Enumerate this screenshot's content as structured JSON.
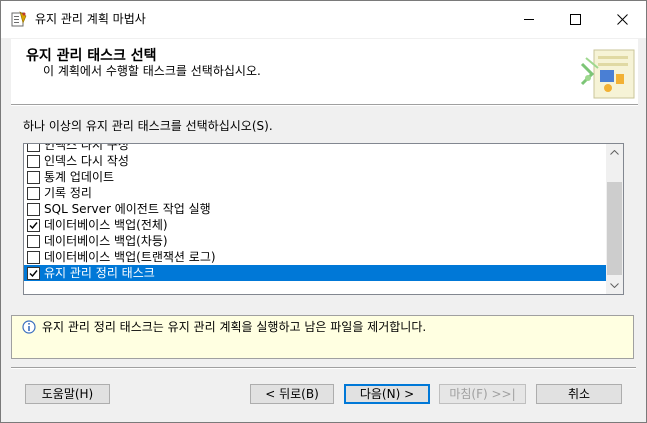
{
  "window": {
    "title": "유지 관리 계획 마법사"
  },
  "header": {
    "title": "유지 관리 태스크 선택",
    "subtitle": "이 계획에서 수행할 태스크를 선택하십시오."
  },
  "instruction": "하나 이상의 유지 관리 태스크를 선택하십시오(S).",
  "tasks": [
    {
      "label": "인덱스 다시 구성",
      "checked": false,
      "selected": false
    },
    {
      "label": "인덱스 다시 작성",
      "checked": false,
      "selected": false
    },
    {
      "label": "통계 업데이트",
      "checked": false,
      "selected": false
    },
    {
      "label": "기록 정리",
      "checked": false,
      "selected": false
    },
    {
      "label": "SQL Server 에이전트 작업 실행",
      "checked": false,
      "selected": false
    },
    {
      "label": "데이터베이스 백업(전체)",
      "checked": true,
      "selected": false
    },
    {
      "label": "데이터베이스 백업(차등)",
      "checked": false,
      "selected": false
    },
    {
      "label": "데이터베이스 백업(트랜잭션 로그)",
      "checked": false,
      "selected": false
    },
    {
      "label": "유지 관리 정리 태스크",
      "checked": true,
      "selected": true
    }
  ],
  "description": "유지 관리 정리 태스크는 유지 관리 계획을 실행하고 남은 파일을 제거합니다.",
  "buttons": {
    "help": "도움말(H)",
    "back": "< 뒤로(B)",
    "next": "다음(N) >",
    "finish": "마침(F) >>|",
    "cancel": "취소"
  },
  "colors": {
    "selection": "#0078d7",
    "description_background": "#ffffe1",
    "window_background": "#f0f0f0"
  }
}
